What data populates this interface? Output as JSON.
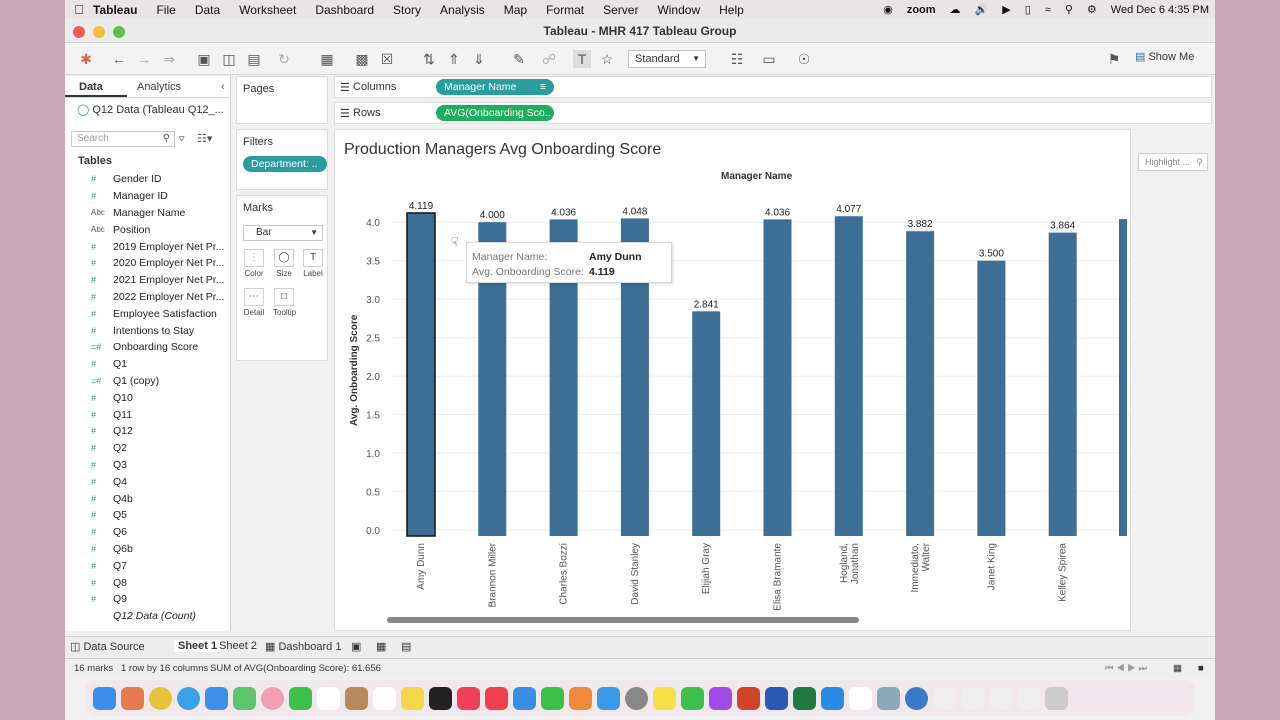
{
  "menubar": {
    "items": [
      "Tableau",
      "File",
      "Data",
      "Worksheet",
      "Dashboard",
      "Story",
      "Analysis",
      "Map",
      "Format",
      "Server",
      "Window",
      "Help"
    ],
    "zoom": "zoom",
    "datetime": "Wed Dec 6  4:35 PM"
  },
  "window": {
    "title": "Tableau - MHR 417 Tableau Group"
  },
  "toolbar": {
    "fit": "Standard",
    "show_me": "Show Me"
  },
  "data_pane": {
    "tab_data": "Data",
    "tab_analytics": "Analytics",
    "datasource": "Q12 Data (Tableau Q12_...",
    "search_placeholder": "Search",
    "tables_heading": "Tables",
    "fields": [
      {
        "name": "Gender ID",
        "type": "#"
      },
      {
        "name": "Manager ID",
        "type": "#"
      },
      {
        "name": "Manager Name",
        "type": "Abc"
      },
      {
        "name": "Position",
        "type": "Abc"
      },
      {
        "name": "2019 Employer Net Pr...",
        "type": "#"
      },
      {
        "name": "2020 Employer Net Pr...",
        "type": "#"
      },
      {
        "name": "2021 Employer Net Pr...",
        "type": "#"
      },
      {
        "name": "2022 Employer Net Pr...",
        "type": "#"
      },
      {
        "name": "Employee Satisfaction",
        "type": "#"
      },
      {
        "name": "Intentions to Stay",
        "type": "#"
      },
      {
        "name": "Onboarding Score",
        "type": "=#"
      },
      {
        "name": "Q1",
        "type": "#"
      },
      {
        "name": "Q1 (copy)",
        "type": "=#"
      },
      {
        "name": "Q10",
        "type": "#"
      },
      {
        "name": "Q11",
        "type": "#"
      },
      {
        "name": "Q12",
        "type": "#"
      },
      {
        "name": "Q2",
        "type": "#"
      },
      {
        "name": "Q3",
        "type": "#"
      },
      {
        "name": "Q4",
        "type": "#"
      },
      {
        "name": "Q4b",
        "type": "#"
      },
      {
        "name": "Q5",
        "type": "#"
      },
      {
        "name": "Q6",
        "type": "#"
      },
      {
        "name": "Q6b",
        "type": "#"
      },
      {
        "name": "Q7",
        "type": "#"
      },
      {
        "name": "Q8",
        "type": "#"
      },
      {
        "name": "Q9",
        "type": "#"
      },
      {
        "name": "Q12 Data (Count)",
        "type": "",
        "italic": true
      }
    ]
  },
  "cards": {
    "pages": "Pages",
    "filters": "Filters",
    "filter_pill": "Department: ..",
    "marks": "Marks",
    "mark_type": "Bar",
    "mark_buttons": [
      "Color",
      "Size",
      "Label",
      "Detail",
      "Tooltip"
    ]
  },
  "shelves": {
    "columns_label": "Columns",
    "columns_pill": "Manager Name",
    "rows_label": "Rows",
    "rows_pill": "AVG(Onboarding Sco.."
  },
  "highlight_placeholder": "Highlight ...",
  "tooltip": {
    "k1": "Manager Name:",
    "v1": "Amy Dunn",
    "k2": "Avg. Onboarding Score:",
    "v2": "4.119"
  },
  "chart_data": {
    "type": "bar",
    "title": "Production Managers Avg Onboarding Score",
    "xlabel": "Manager Name",
    "ylabel": "Avg. Onboarding Score",
    "ylim": [
      0,
      4.119
    ],
    "yticks": [
      "0.0",
      "0.5",
      "1.0",
      "1.5",
      "2.0",
      "2.5",
      "3.0",
      "3.5",
      "4.0"
    ],
    "categories": [
      "Amy Dunn",
      "Brannon Miller",
      "Charles Bozzi",
      "David Stanley",
      "Elijiah Gray",
      "Elisa Bramante",
      "Hogland,\nJonathan",
      "Immediato,\nWalter",
      "Janet King",
      "Kelley Spirea"
    ],
    "values": [
      4.119,
      4.0,
      4.036,
      4.048,
      2.841,
      4.036,
      4.077,
      3.882,
      3.5,
      3.864
    ],
    "labels": [
      "4.119",
      "4.000",
      "4.036",
      "4.048",
      "2.841",
      "4.036",
      "4.077",
      "3.882",
      "3.500",
      "3.864"
    ],
    "color": "#3c6e96",
    "selected": "Amy Dunn"
  },
  "bottom_tabs": [
    "Data Source",
    "Sheet 1",
    "Sheet 2",
    "Dashboard 1"
  ],
  "status": {
    "marks": "16 marks",
    "rows_cols": "1 row by 16 columns",
    "sum": "SUM of AVG(Onboarding Score): 61.656"
  }
}
